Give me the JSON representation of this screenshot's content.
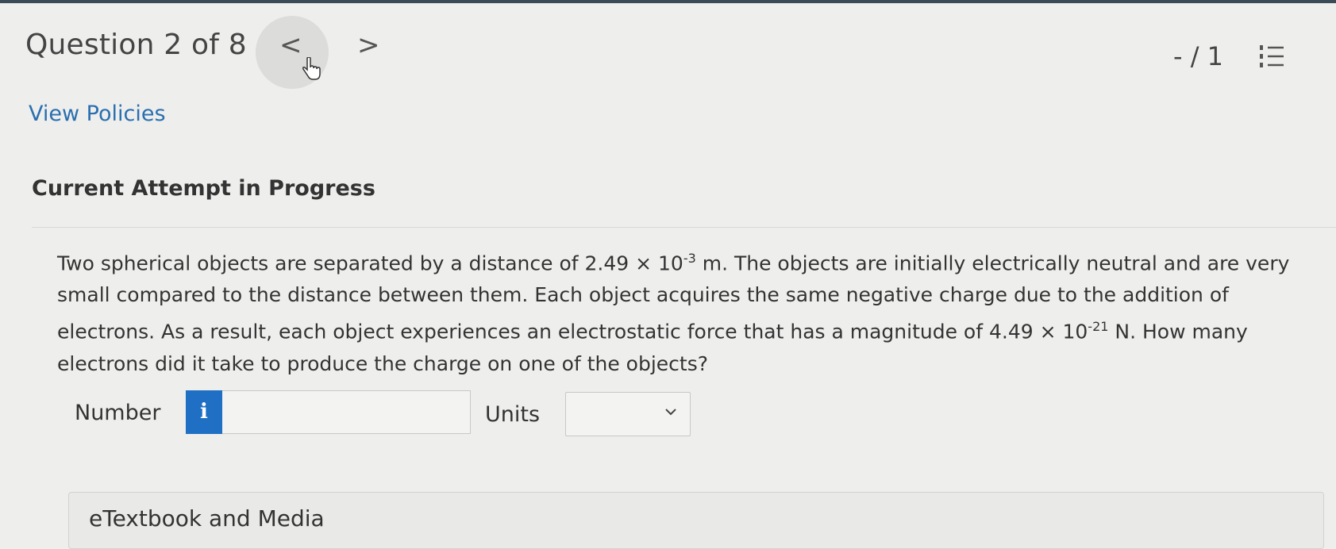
{
  "header": {
    "question_title": "Question 2 of 8",
    "prev_symbol": "<",
    "next_symbol": ">",
    "score": "- / 1"
  },
  "links": {
    "view_policies": "View Policies"
  },
  "attempt": {
    "heading": "Current Attempt in Progress"
  },
  "question": {
    "part1": "Two spherical objects are separated by a distance of 2.49 × 10",
    "exp1": "-3",
    "part2": " m. The objects are initially electrically neutral and are very small compared to the distance between them. Each object acquires the same negative charge due to the addition of electrons. As a result, each object experiences an electrostatic force that has a magnitude of 4.49 × 10",
    "exp2": "-21",
    "part3": " N. How many electrons did it take to produce the charge on one of the objects?"
  },
  "answer": {
    "number_label": "Number",
    "info_symbol": "i",
    "number_value": "",
    "units_label": "Units",
    "units_value": ""
  },
  "resources": {
    "etextbook_label": "eTextbook and Media"
  },
  "colors": {
    "link": "#2a6fb0",
    "info_button": "#1f6fc4",
    "background": "#eeeeec"
  },
  "icons": [
    "chevron-left-icon",
    "chevron-right-icon",
    "hand-cursor-icon",
    "numbered-list-icon",
    "chevron-down-icon"
  ]
}
